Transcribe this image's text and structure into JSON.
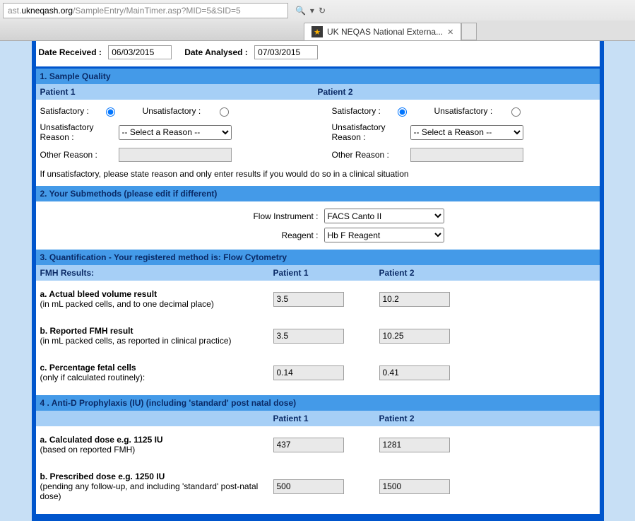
{
  "browser": {
    "url_prefix": "ast.",
    "url_domain": "ukneqash.org",
    "url_path": "/SampleEntry/MainTimer.asp?MID=5&SID=5",
    "search_glyph": "🔍",
    "refresh_glyph": "↻",
    "tab_title": "UK NEQAS National Externa...",
    "tab_star": "★",
    "tab_close": "✕"
  },
  "dates": {
    "received_label": "Date Received :",
    "received_value": "06/03/2015",
    "analysed_label": "Date Analysed :",
    "analysed_value": "07/03/2015"
  },
  "section1": {
    "title": "1. Sample Quality",
    "patient1_label": "Patient 1",
    "patient2_label": "Patient 2",
    "satisfactory_label": "Satisfactory :",
    "unsatisfactory_label": "Unsatisfactory :",
    "reason_label": "Unsatisfactory Reason :",
    "reason_placeholder": "-- Select a Reason --",
    "other_label": "Other Reason :",
    "note": "If unsatisfactory, please state reason and only enter results if you would do so in a clinical situation"
  },
  "section2": {
    "title": "2. Your Submethods (please edit if different)",
    "flow_label": "Flow Instrument :",
    "flow_value": "FACS Canto II",
    "reagent_label": "Reagent :",
    "reagent_value": "Hb F Reagent"
  },
  "section3": {
    "title": "3. Quantification - Your registered method is: Flow Cytometry",
    "header_left": "FMH Results:",
    "header_p1": "Patient 1",
    "header_p2": "Patient 2",
    "rows": [
      {
        "label_bold": "a. Actual bleed volume result",
        "label_small": "(in mL packed cells, and to one decimal place)",
        "p1": "3.5",
        "p2": "10.2"
      },
      {
        "label_bold": "b. Reported FMH result",
        "label_small": "(in mL packed cells, as reported in clinical practice)",
        "p1": "3.5",
        "p2": "10.25"
      },
      {
        "label_bold": "c. Percentage fetal cells",
        "label_small": "(only if calculated routinely):",
        "p1": "0.14",
        "p2": "0.41"
      }
    ]
  },
  "section4": {
    "title": "4 . Anti-D Prophylaxis (IU) (including 'standard' post natal dose)",
    "header_p1": "Patient 1",
    "header_p2": "Patient 2",
    "rows": [
      {
        "label_bold": "a. Calculated dose e.g. 1125 IU",
        "label_small": "(based on reported FMH)",
        "p1": "437",
        "p2": "1281"
      },
      {
        "label_bold": "b. Prescribed dose e.g. 1250 IU",
        "label_small": "(pending any follow-up, and including 'standard' post-natal dose)",
        "p1": "500",
        "p2": "1500"
      }
    ]
  }
}
